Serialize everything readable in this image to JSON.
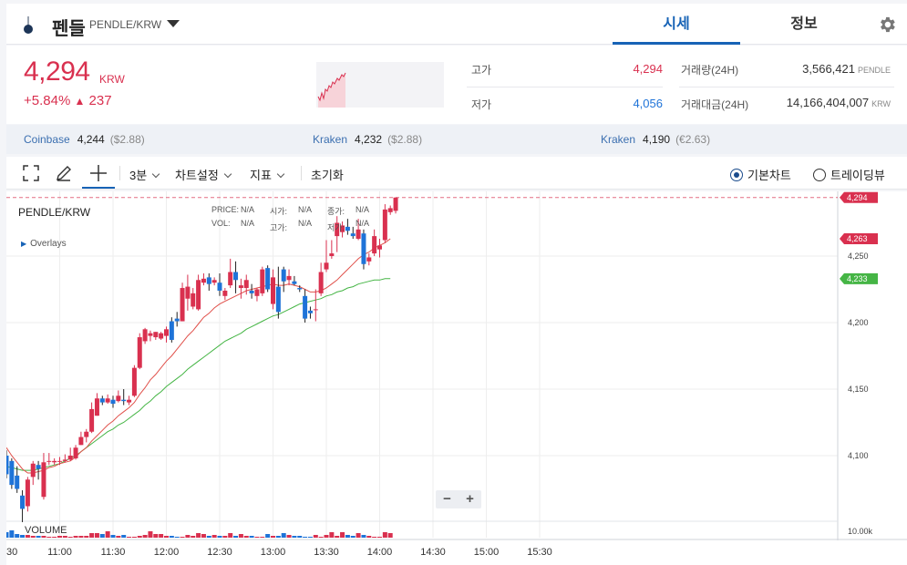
{
  "header": {
    "coin_name": "펜들",
    "pair": "PENDLE/KRW",
    "tabs": [
      "시세",
      "정보"
    ]
  },
  "summary": {
    "price": "4,294",
    "price_unit": "KRW",
    "change_pct": "+5.84%",
    "change_arrow": "▲",
    "change_abs": "237",
    "high_label": "고가",
    "high_value": "4,294",
    "low_label": "저가",
    "low_value": "4,056",
    "volume_label": "거래량(24H)",
    "volume_value": "3,566,421",
    "volume_unit": "PENDLE",
    "amount_label": "거래대금(24H)",
    "amount_value": "14,166,404,007",
    "amount_unit": "KRW"
  },
  "exchanges": [
    {
      "name": "Coinbase",
      "price": "4,244",
      "sub": "($2.88)"
    },
    {
      "name": "Kraken",
      "price": "4,232",
      "sub": "($2.88)"
    },
    {
      "name": "Kraken",
      "price": "4,190",
      "sub": "(€2.63)"
    }
  ],
  "toolbar": {
    "interval": "3분",
    "chart_settings": "차트설정",
    "indicators": "지표",
    "reset": "초기화",
    "basic_chart": "기본차트",
    "trading_view": "트레이딩뷰"
  },
  "chart_legend": {
    "pair": "PENDLE/KRW",
    "overlays": "Overlays",
    "price_label": "PRICE:",
    "vol_label": "VOL:",
    "open_label": "시가:",
    "high_label": "고가:",
    "close_label": "종가:",
    "low_label": "저가:",
    "na": "N/A",
    "volume": "VOLUME"
  },
  "colors": {
    "up": "#d9304f",
    "down": "#1e73d8",
    "ma_fast": "#e0504a",
    "ma_slow": "#45b545",
    "accent": "#1763b6"
  },
  "chart_data": {
    "type": "candlestick",
    "pair": "PENDLE/KRW",
    "interval": "3분",
    "y_ticks": [
      "4,100",
      "4,150",
      "4,200",
      "4,250"
    ],
    "x_ticks": [
      "11:00",
      "11:30",
      "12:00",
      "12:30",
      "13:00",
      "13:30",
      "14:00",
      "14:30",
      "15:00",
      "15:30"
    ],
    "volume_tick": "10.00k",
    "price_tags": [
      {
        "label": "4,294",
        "color": "#d9304f"
      },
      {
        "label": "4,263",
        "color": "#d9304f"
      },
      {
        "label": "4,233",
        "color": "#45b545"
      }
    ],
    "candles": [
      {
        "t": "10:30",
        "o": 4100,
        "h": 4104,
        "l": 4083,
        "c": 4086
      },
      {
        "t": "10:33",
        "o": 4096,
        "h": 4098,
        "l": 4075,
        "c": 4078
      },
      {
        "t": "10:36",
        "o": 4085,
        "h": 4092,
        "l": 4072,
        "c": 4075
      },
      {
        "t": "10:39",
        "o": 4070,
        "h": 4074,
        "l": 4050,
        "c": 4060
      },
      {
        "t": "10:42",
        "o": 4062,
        "h": 4084,
        "l": 4058,
        "c": 4082
      },
      {
        "t": "10:45",
        "o": 4084,
        "h": 4096,
        "l": 4078,
        "c": 4094
      },
      {
        "t": "10:48",
        "o": 4093,
        "h": 4096,
        "l": 4082,
        "c": 4090
      },
      {
        "t": "10:51",
        "o": 4069,
        "h": 4102,
        "l": 4067,
        "c": 4095
      },
      {
        "t": "10:54",
        "o": 4096,
        "h": 4102,
        "l": 4093,
        "c": 4096
      },
      {
        "t": "10:57",
        "o": 4095,
        "h": 4098,
        "l": 4093,
        "c": 4096
      },
      {
        "t": "11:00",
        "o": 4096,
        "h": 4099,
        "l": 4093,
        "c": 4096
      },
      {
        "t": "11:03",
        "o": 4096,
        "h": 4101,
        "l": 4095,
        "c": 4097
      },
      {
        "t": "11:06",
        "o": 4097,
        "h": 4106,
        "l": 4096,
        "c": 4100
      },
      {
        "t": "11:09",
        "o": 4098,
        "h": 4108,
        "l": 4097,
        "c": 4106
      },
      {
        "t": "11:12",
        "o": 4108,
        "h": 4118,
        "l": 4108,
        "c": 4114
      },
      {
        "t": "11:15",
        "o": 4114,
        "h": 4120,
        "l": 4110,
        "c": 4118
      },
      {
        "t": "11:18",
        "o": 4118,
        "h": 4140,
        "l": 4117,
        "c": 4135
      },
      {
        "t": "11:21",
        "o": 4130,
        "h": 4147,
        "l": 4130,
        "c": 4143
      },
      {
        "t": "11:24",
        "o": 4143,
        "h": 4145,
        "l": 4138,
        "c": 4140
      },
      {
        "t": "11:27",
        "o": 4140,
        "h": 4146,
        "l": 4139,
        "c": 4143
      },
      {
        "t": "11:30",
        "o": 4142,
        "h": 4145,
        "l": 4136,
        "c": 4139
      },
      {
        "t": "11:33",
        "o": 4141,
        "h": 4149,
        "l": 4140,
        "c": 4145
      },
      {
        "t": "11:36",
        "o": 4142,
        "h": 4150,
        "l": 4138,
        "c": 4141
      },
      {
        "t": "11:39",
        "o": 4140,
        "h": 4145,
        "l": 4138,
        "c": 4142
      },
      {
        "t": "11:42",
        "o": 4145,
        "h": 4168,
        "l": 4144,
        "c": 4166
      },
      {
        "t": "11:45",
        "o": 4166,
        "h": 4192,
        "l": 4165,
        "c": 4189
      },
      {
        "t": "11:48",
        "o": 4186,
        "h": 4196,
        "l": 4184,
        "c": 4195
      },
      {
        "t": "11:51",
        "o": 4190,
        "h": 4194,
        "l": 4186,
        "c": 4192
      },
      {
        "t": "11:54",
        "o": 4189,
        "h": 4193,
        "l": 4187,
        "c": 4193
      },
      {
        "t": "11:57",
        "o": 4188,
        "h": 4193,
        "l": 4187,
        "c": 4192
      },
      {
        "t": "12:00",
        "o": 4190,
        "h": 4197,
        "l": 4185,
        "c": 4195
      },
      {
        "t": "12:03",
        "o": 4201,
        "h": 4204,
        "l": 4185,
        "c": 4187
      },
      {
        "t": "12:06",
        "o": 4203,
        "h": 4208,
        "l": 4197,
        "c": 4201
      },
      {
        "t": "12:09",
        "o": 4201,
        "h": 4230,
        "l": 4201,
        "c": 4226
      },
      {
        "t": "12:12",
        "o": 4218,
        "h": 4236,
        "l": 4209,
        "c": 4227
      },
      {
        "t": "12:15",
        "o": 4212,
        "h": 4226,
        "l": 4210,
        "c": 4222
      },
      {
        "t": "12:18",
        "o": 4210,
        "h": 4236,
        "l": 4209,
        "c": 4232
      },
      {
        "t": "12:21",
        "o": 4230,
        "h": 4237,
        "l": 4228,
        "c": 4233
      },
      {
        "t": "12:24",
        "o": 4234,
        "h": 4237,
        "l": 4224,
        "c": 4229
      },
      {
        "t": "12:27",
        "o": 4230,
        "h": 4234,
        "l": 4228,
        "c": 4232
      },
      {
        "t": "12:30",
        "o": 4230,
        "h": 4237,
        "l": 4220,
        "c": 4224
      },
      {
        "t": "12:33",
        "o": 4220,
        "h": 4226,
        "l": 4217,
        "c": 4224
      },
      {
        "t": "12:36",
        "o": 4228,
        "h": 4248,
        "l": 4226,
        "c": 4238
      },
      {
        "t": "12:39",
        "o": 4238,
        "h": 4246,
        "l": 4222,
        "c": 4232
      },
      {
        "t": "12:42",
        "o": 4226,
        "h": 4233,
        "l": 4218,
        "c": 4228
      },
      {
        "t": "12:45",
        "o": 4226,
        "h": 4236,
        "l": 4221,
        "c": 4232
      },
      {
        "t": "12:48",
        "o": 4224,
        "h": 4229,
        "l": 4218,
        "c": 4222
      },
      {
        "t": "12:51",
        "o": 4220,
        "h": 4226,
        "l": 4216,
        "c": 4225
      },
      {
        "t": "12:54",
        "o": 4222,
        "h": 4242,
        "l": 4220,
        "c": 4240
      },
      {
        "t": "12:57",
        "o": 4241,
        "h": 4243,
        "l": 4223,
        "c": 4225
      },
      {
        "t": "13:00",
        "o": 4214,
        "h": 4240,
        "l": 4210,
        "c": 4234
      },
      {
        "t": "13:03",
        "o": 4227,
        "h": 4242,
        "l": 4203,
        "c": 4208
      },
      {
        "t": "13:06",
        "o": 4240,
        "h": 4242,
        "l": 4223,
        "c": 4231
      },
      {
        "t": "13:09",
        "o": 4232,
        "h": 4240,
        "l": 4228,
        "c": 4235
      },
      {
        "t": "13:12",
        "o": 4231,
        "h": 4235,
        "l": 4228,
        "c": 4229
      },
      {
        "t": "13:15",
        "o": 4226,
        "h": 4228,
        "l": 4223,
        "c": 4225
      },
      {
        "t": "13:18",
        "o": 4220,
        "h": 4225,
        "l": 4200,
        "c": 4203
      },
      {
        "t": "13:21",
        "o": 4209,
        "h": 4212,
        "l": 4203,
        "c": 4207
      },
      {
        "t": "13:24",
        "o": 4210,
        "h": 4225,
        "l": 4201,
        "c": 4210
      },
      {
        "t": "13:27",
        "o": 4222,
        "h": 4245,
        "l": 4220,
        "c": 4238
      },
      {
        "t": "13:30",
        "o": 4240,
        "h": 4262,
        "l": 4238,
        "c": 4245
      },
      {
        "t": "13:33",
        "o": 4250,
        "h": 4262,
        "l": 4248,
        "c": 4252
      },
      {
        "t": "13:36",
        "o": 4265,
        "h": 4280,
        "l": 4253,
        "c": 4275
      },
      {
        "t": "13:39",
        "o": 4268,
        "h": 4276,
        "l": 4264,
        "c": 4273
      },
      {
        "t": "13:42",
        "o": 4272,
        "h": 4278,
        "l": 4266,
        "c": 4269
      },
      {
        "t": "13:45",
        "o": 4267,
        "h": 4272,
        "l": 4263,
        "c": 4265
      },
      {
        "t": "13:48",
        "o": 4263,
        "h": 4278,
        "l": 4262,
        "c": 4270
      },
      {
        "t": "13:51",
        "o": 4267,
        "h": 4270,
        "l": 4240,
        "c": 4244
      },
      {
        "t": "13:54",
        "o": 4246,
        "h": 4252,
        "l": 4243,
        "c": 4249
      },
      {
        "t": "13:57",
        "o": 4252,
        "h": 4270,
        "l": 4250,
        "c": 4265
      },
      {
        "t": "14:00",
        "o": 4255,
        "h": 4263,
        "l": 4249,
        "c": 4258
      },
      {
        "t": "14:03",
        "o": 4262,
        "h": 4289,
        "l": 4260,
        "c": 4285
      },
      {
        "t": "14:06",
        "o": 4283,
        "h": 4288,
        "l": 4281,
        "c": 4286
      },
      {
        "t": "14:09",
        "o": 4284,
        "h": 4294,
        "l": 4282,
        "c": 4294
      }
    ],
    "ma_fast": [
      4106,
      4100,
      4095,
      4090,
      4087,
      4087,
      4088,
      4089,
      4091,
      4092,
      4094,
      4095,
      4096,
      4099,
      4103,
      4106,
      4111,
      4115,
      4119,
      4123,
      4126,
      4130,
      4133,
      4136,
      4140,
      4146,
      4151,
      4157,
      4161,
      4166,
      4171,
      4175,
      4180,
      4185,
      4190,
      4194,
      4199,
      4204,
      4207,
      4211,
      4214,
      4216,
      4218,
      4220,
      4222,
      4224,
      4225,
      4226,
      4227,
      4228,
      4229,
      4228,
      4228,
      4229,
      4228,
      4227,
      4225,
      4223,
      4223,
      4224,
      4226,
      4229,
      4232,
      4236,
      4240,
      4244,
      4248,
      4251,
      4253,
      4256,
      4258,
      4260,
      4263
    ],
    "ma_slow": [
      4092,
      4091,
      4090,
      4089,
      4089,
      4089,
      4090,
      4091,
      4092,
      4093,
      4094,
      4096,
      4098,
      4100,
      4103,
      4106,
      4109,
      4112,
      4115,
      4118,
      4120,
      4123,
      4125,
      4128,
      4131,
      4134,
      4138,
      4141,
      4145,
      4148,
      4152,
      4155,
      4158,
      4161,
      4165,
      4168,
      4171,
      4174,
      4177,
      4180,
      4183,
      4186,
      4188,
      4190,
      4192,
      4195,
      4197,
      4199,
      4201,
      4203,
      4205,
      4206,
      4208,
      4210,
      4212,
      4214,
      4215,
      4216,
      4217,
      4218,
      4220,
      4221,
      4223,
      4224,
      4226,
      4227,
      4229,
      4230,
      4231,
      4232,
      4232,
      4233,
      4233
    ],
    "volumes": [
      0.6,
      0.8,
      0.4,
      0.3,
      0.3,
      0.2,
      0.2,
      0.2,
      0.1,
      0.1,
      0.2,
      0.2,
      0.1,
      0.2,
      0.2,
      0.2,
      0.5,
      0.5,
      0.4,
      0.7,
      0.3,
      0.2,
      0.3,
      0.1,
      0.1,
      0.2,
      0.3,
      0.7,
      0.4,
      0.4,
      0.2,
      0.2,
      0.1,
      0.1,
      0.3,
      0.2,
      0.5,
      0.4,
      0.2,
      0.3,
      0.2,
      0.2,
      0.5,
      0.2,
      0.4,
      0.2,
      0.2,
      0.1,
      0.1,
      0.4,
      0.2,
      0.2,
      0.5,
      0.3,
      0.2,
      0.2,
      0.1,
      0.1,
      0.3,
      0.1,
      0.3,
      0.6,
      0.2,
      0.6,
      0.3,
      0.2,
      0.5,
      0.3,
      0.2,
      0.1,
      0.1,
      0.6,
      0.5
    ]
  }
}
